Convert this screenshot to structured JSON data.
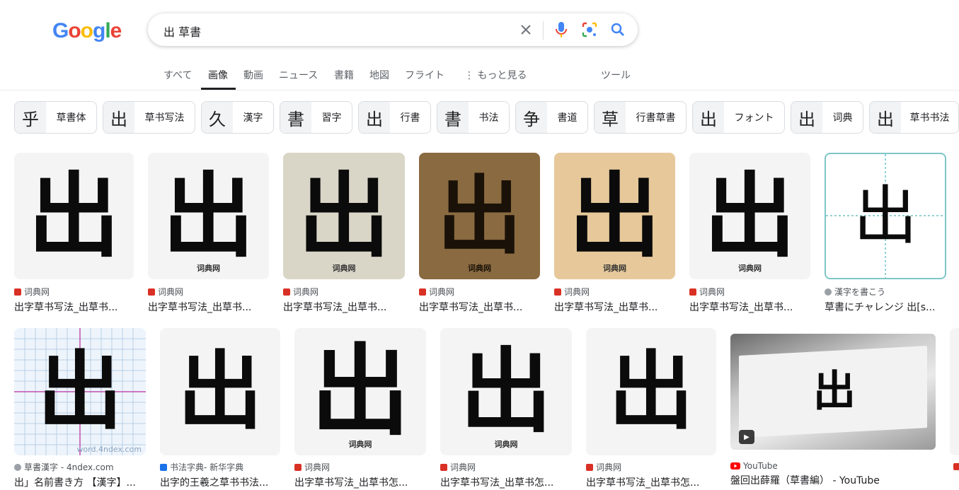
{
  "logo": {
    "letters": [
      "G",
      "o",
      "o",
      "g",
      "l",
      "e"
    ]
  },
  "search": {
    "query": "出 草書"
  },
  "tabs": [
    {
      "label": "すべて"
    },
    {
      "label": "画像"
    },
    {
      "label": "動画"
    },
    {
      "label": "ニュース"
    },
    {
      "label": "書籍"
    },
    {
      "label": "地図"
    },
    {
      "label": "フライト"
    },
    {
      "label": "もっと見る"
    }
  ],
  "tools_label": "ツール",
  "chips": [
    {
      "label": "草書体",
      "glyph": "乎"
    },
    {
      "label": "草书写法",
      "glyph": "出"
    },
    {
      "label": "漢字",
      "glyph": "久"
    },
    {
      "label": "習字",
      "glyph": "書"
    },
    {
      "label": "行書",
      "glyph": "出"
    },
    {
      "label": "书法",
      "glyph": "書"
    },
    {
      "label": "書道",
      "glyph": "争"
    },
    {
      "label": "行書草書",
      "glyph": "草"
    },
    {
      "label": "フォント",
      "glyph": "出"
    },
    {
      "label": "词典",
      "glyph": "出"
    },
    {
      "label": "草书书法",
      "glyph": "出"
    }
  ],
  "row1": [
    {
      "source": "词典网",
      "title": "出字草书写法_出草书...",
      "glyph": "出",
      "watermark": ""
    },
    {
      "source": "词典网",
      "title": "出字草书写法_出草书...",
      "glyph": "出",
      "watermark": "词典网"
    },
    {
      "source": "词典网",
      "title": "出字草书写法_出草书...",
      "glyph": "出",
      "watermark": "词典网"
    },
    {
      "source": "词典网",
      "title": "出字草书写法_出草书...",
      "glyph": "出",
      "watermark": "词典网"
    },
    {
      "source": "词典网",
      "title": "出字草书写法_出草书...",
      "glyph": "出",
      "watermark": "词典网"
    },
    {
      "source": "词典网",
      "title": "出字草书写法_出草书...",
      "glyph": "出",
      "watermark": "词典网"
    },
    {
      "source": "漢字を書こう",
      "title": "草書にチャレンジ 出[s...",
      "glyph": "出",
      "watermark": ""
    }
  ],
  "row2": [
    {
      "source": "草書漢字 - 4ndex.com",
      "title": "出」名前書き方 【漢字】...",
      "glyph": "出",
      "watermark": "word.4ndex.com"
    },
    {
      "source": "书法字典- 新华字典",
      "title": "出字的王羲之草书书法...",
      "glyph": "出",
      "watermark": ""
    },
    {
      "source": "词典网",
      "title": "出字草书写法_出草书怎...",
      "glyph": "出",
      "watermark": "词典网"
    },
    {
      "source": "词典网",
      "title": "出字草书写法_出草书怎...",
      "glyph": "出",
      "watermark": "词典网"
    },
    {
      "source": "词典网",
      "title": "出字草书写法_出草书怎...",
      "glyph": "出",
      "watermark": ""
    },
    {
      "source": "YouTube",
      "title": "盤回出薛羅（草書編） - YouTube",
      "glyph": "出",
      "watermark": ""
    }
  ],
  "colors": {
    "blue": "#4285F4",
    "red": "#EA4335",
    "yellow": "#FBBC05",
    "green": "#34A853",
    "source_red": "#d93025"
  }
}
